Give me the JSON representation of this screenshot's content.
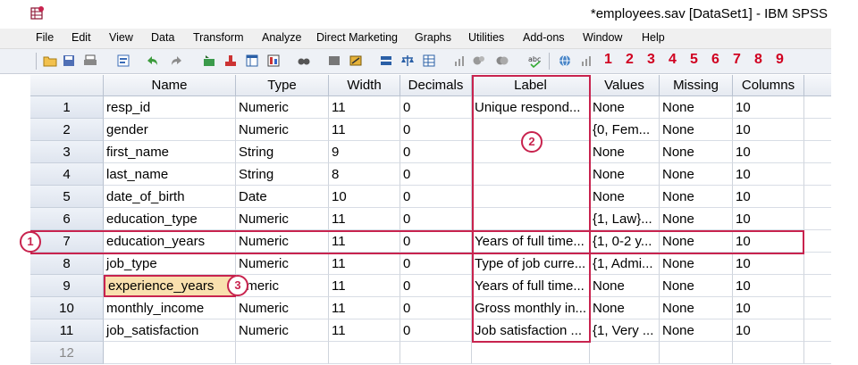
{
  "window": {
    "title": "*employees.sav [DataSet1] - IBM SPSS"
  },
  "menu": [
    "File",
    "Edit",
    "View",
    "Data",
    "Transform",
    "Analyze",
    "Direct Marketing",
    "Graphs",
    "Utilities",
    "Add-ons",
    "Window",
    "Help"
  ],
  "toolbar": {
    "icons": [
      "open-icon",
      "save-icon",
      "print-icon",
      "dialog-recall-icon",
      "undo-icon",
      "redo-icon",
      "goto-case-icon",
      "goto-variable-icon",
      "variables-icon",
      "run-descriptives-icon",
      "find-icon",
      "insert-cases-icon",
      "insert-variable-icon",
      "split-file-icon",
      "weight-cases-icon",
      "select-cases-icon",
      "value-labels-icon",
      "use-sets-icon",
      "show-all-icon",
      "spell-check-icon",
      "globe-icon",
      "scale-icon"
    ],
    "numbers": [
      "1",
      "2",
      "3",
      "4",
      "5",
      "6",
      "7",
      "8",
      "9"
    ]
  },
  "grid": {
    "columns": [
      "Name",
      "Type",
      "Width",
      "Decimals",
      "Label",
      "Values",
      "Missing",
      "Columns"
    ],
    "rows": [
      {
        "num": "1",
        "cells": [
          "resp_id",
          "Numeric",
          "11",
          "0",
          "Unique respond...",
          "None",
          "None",
          "10"
        ]
      },
      {
        "num": "2",
        "cells": [
          "gender",
          "Numeric",
          "11",
          "0",
          "",
          "{0, Fem...",
          "None",
          "10"
        ]
      },
      {
        "num": "3",
        "cells": [
          "first_name",
          "String",
          "9",
          "0",
          "",
          "None",
          "None",
          "10"
        ]
      },
      {
        "num": "4",
        "cells": [
          "last_name",
          "String",
          "8",
          "0",
          "",
          "None",
          "None",
          "10"
        ]
      },
      {
        "num": "5",
        "cells": [
          "date_of_birth",
          "Date",
          "10",
          "0",
          "",
          "None",
          "None",
          "10"
        ]
      },
      {
        "num": "6",
        "cells": [
          "education_type",
          "Numeric",
          "11",
          "0",
          "",
          "{1, Law}...",
          "None",
          "10"
        ]
      },
      {
        "num": "7",
        "cells": [
          "education_years",
          "Numeric",
          "11",
          "0",
          "Years of full time...",
          "{1, 0-2 y...",
          "None",
          "10"
        ]
      },
      {
        "num": "8",
        "cells": [
          "job_type",
          "Numeric",
          "11",
          "0",
          "Type of job curre...",
          "{1, Admi...",
          "None",
          "10"
        ]
      },
      {
        "num": "9",
        "cells": [
          "experience_years",
          "umeric",
          "11",
          "0",
          "Years of full time...",
          "None",
          "None",
          "10"
        ]
      },
      {
        "num": "10",
        "cells": [
          "monthly_income",
          "Numeric",
          "11",
          "0",
          "Gross monthly in...",
          "None",
          "None",
          "10"
        ]
      },
      {
        "num": "11",
        "cells": [
          "job_satisfaction",
          "Numeric",
          "11",
          "0",
          "Job satisfaction ...",
          "{1, Very ...",
          "None",
          "10"
        ]
      },
      {
        "num": "12",
        "cells": [
          "",
          "",
          "",
          "",
          "",
          "",
          "",
          ""
        ]
      }
    ],
    "selected_cell": {
      "row": "9",
      "column": "Name"
    }
  },
  "annotations": [
    "1",
    "2",
    "3"
  ],
  "colors": {
    "accent": "#c8234e",
    "selected_cell": "#f9e0ae",
    "toolbar_numbers": "#d00020"
  }
}
